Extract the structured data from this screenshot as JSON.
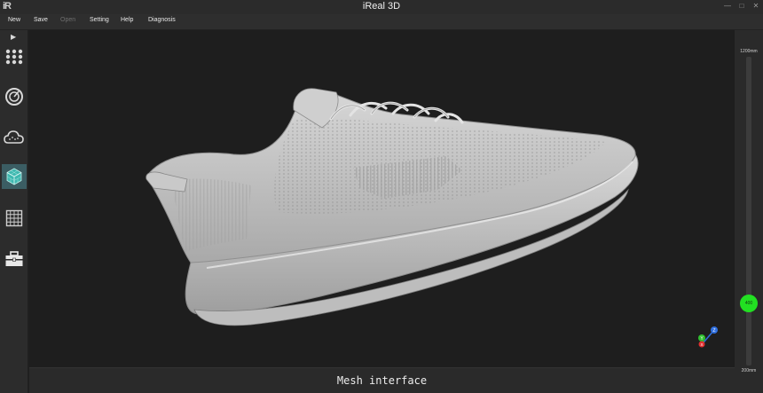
{
  "app": {
    "title": "iReal 3D",
    "logo_text": "iR",
    "window_controls": [
      "—",
      "□",
      "✕"
    ]
  },
  "menu": [
    {
      "label": "New",
      "enabled": true
    },
    {
      "label": "Save",
      "enabled": true
    },
    {
      "label": "Open",
      "enabled": false
    },
    {
      "label": "Setting",
      "enabled": true
    },
    {
      "label": "Help",
      "enabled": true
    },
    {
      "label": "Diagnosis",
      "enabled": true
    }
  ],
  "sidebar": {
    "toggle": "▶",
    "tools": [
      {
        "icon": "grid-dots-icon",
        "active": false
      },
      {
        "icon": "turntable-icon",
        "active": false
      },
      {
        "icon": "cloud-icon",
        "active": false
      },
      {
        "icon": "mesh-cube-icon",
        "active": true
      },
      {
        "icon": "grid-icon",
        "active": false
      },
      {
        "icon": "toolbox-icon",
        "active": false
      }
    ]
  },
  "viewport": {
    "model": "sneaker-mesh",
    "axes": {
      "x": "X",
      "y": "Y",
      "z": "Z"
    }
  },
  "status": {
    "mode_label": "Mesh interface"
  },
  "range_slider": {
    "max_label": "1200mm",
    "min_label": "200mm",
    "value": "400",
    "min": 200,
    "max": 1200,
    "current": 400,
    "thumb_color": "#22e022"
  },
  "colors": {
    "background": "#1e1e1e",
    "panel": "#2c2c2c",
    "active_tool": "#3b5d63",
    "accent": "#22e022",
    "axis_x": "#e03030",
    "axis_y": "#30c030",
    "axis_z": "#3070e0"
  }
}
